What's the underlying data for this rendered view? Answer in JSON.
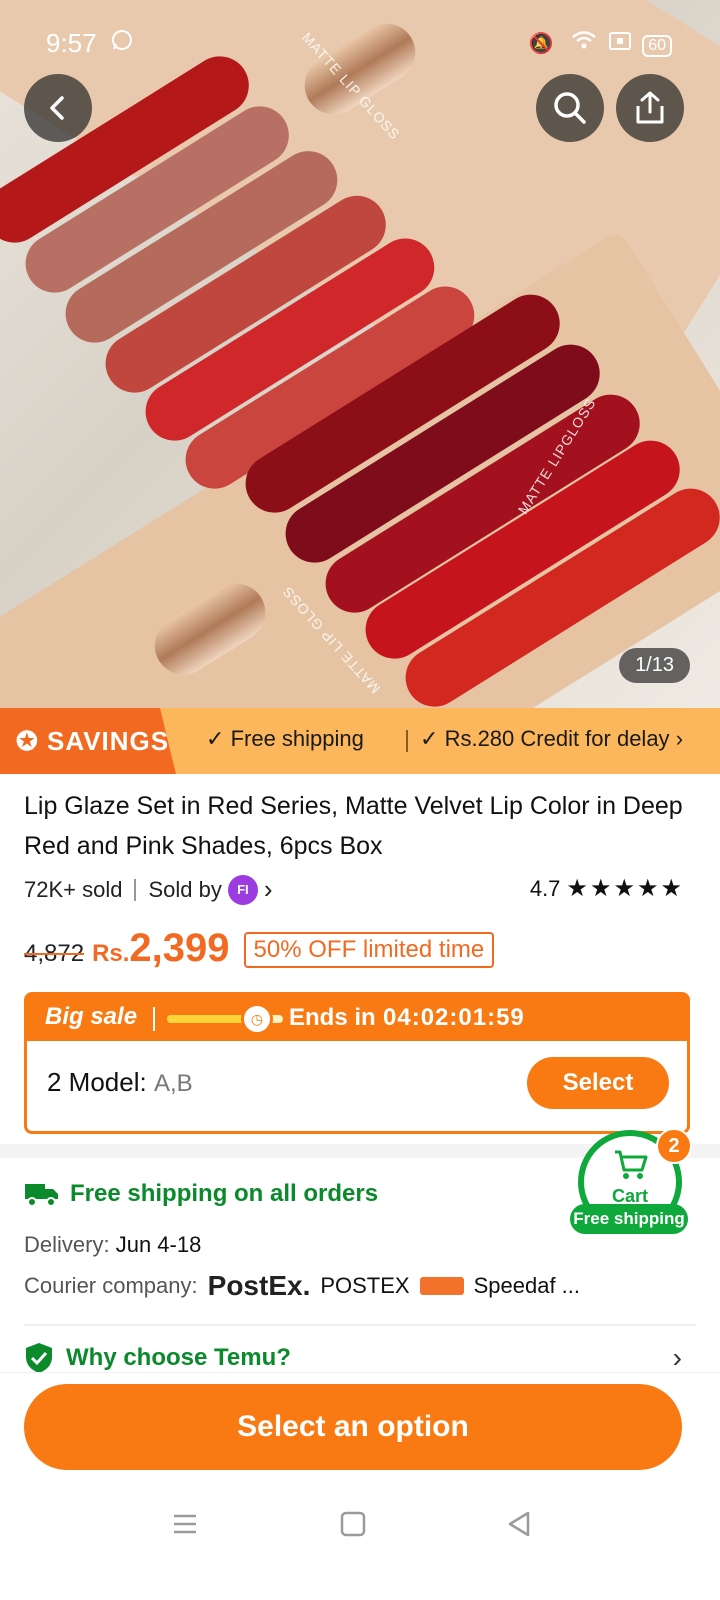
{
  "status_bar": {
    "time": "9:57",
    "battery": "60"
  },
  "gallery": {
    "counter": "1/13",
    "print_top": "MATTE LIP GLOSS",
    "print_bottom": "MATTE LIP GLOSS",
    "print_side": "MATTE LIPGLOSS"
  },
  "savings": {
    "label": "SAVINGS",
    "perk1": "Free shipping",
    "perk2": "Rs.280 Credit for delay"
  },
  "product": {
    "title": "Lip Glaze Set in Red Series, Matte Velvet Lip Color in Deep Red and Pink Shades, 6pcs Box",
    "sold": "72K+ sold",
    "sold_by": "Sold by",
    "seller_initials": "FI",
    "rating": "4.7",
    "stars": "★★★★★",
    "old_price": "4,872",
    "currency": "Rs.",
    "price": "2,399",
    "discount": "50% OFF limited time"
  },
  "sale": {
    "label": "Big sale",
    "progress": 0.75,
    "ends_label": "Ends in",
    "countdown": "04:02:01:59",
    "model_label": "2 Model:",
    "model_values": "A,B",
    "select_label": "Select"
  },
  "shipping": {
    "headline": "Free shipping on all orders",
    "delivery_label": "Delivery:",
    "delivery_value": "Jun 4-18",
    "courier_label": "Courier company:",
    "courier_logo": "PostEx.",
    "courier1": "POSTEX",
    "courier2": "Speedaf ..."
  },
  "why": {
    "label": "Why choose Temu?"
  },
  "cart": {
    "label": "Cart",
    "count": "2",
    "free": "Free shipping"
  },
  "cta": {
    "label": "Select an option"
  },
  "colors": {
    "accent": "#f97a12",
    "green": "#0fa83a",
    "savings_bg": "#fcb75d"
  }
}
